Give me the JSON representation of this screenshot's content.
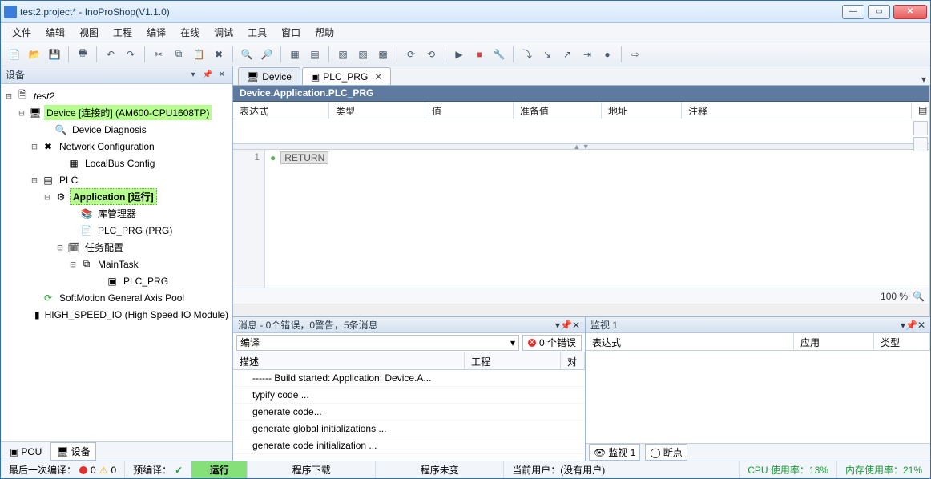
{
  "window": {
    "title": "test2.project* - InoProShop(V1.1.0)"
  },
  "menu": {
    "items": [
      "文件",
      "编辑",
      "视图",
      "工程",
      "编译",
      "在线",
      "调试",
      "工具",
      "窗口",
      "帮助"
    ]
  },
  "devicePanel": {
    "title": "设备",
    "tree": {
      "root": "test2",
      "device": "Device [连接的] (AM600-CPU1608TP)",
      "diag": "Device Diagnosis",
      "netcfg": "Network Configuration",
      "localbus": "LocalBus Config",
      "plc": "PLC",
      "app": "Application [运行]",
      "libmgr": "库管理器",
      "prgdecl": "PLC_PRG (PRG)",
      "taskcfg": "任务配置",
      "maintask": "MainTask",
      "prgcall": "PLC_PRG",
      "softmotion": "SoftMotion General Axis Pool",
      "hsio": "HIGH_SPEED_IO (High Speed IO Module)"
    },
    "bottomTabs": {
      "pou": "POU",
      "dev": "设备"
    }
  },
  "editor": {
    "tabs": {
      "device": "Device",
      "prg": "PLC_PRG"
    },
    "path": "Device.Application.PLC_PRG",
    "varCols": {
      "expr": "表达式",
      "type": "类型",
      "value": "值",
      "prep": "准备值",
      "addr": "地址",
      "comment": "注释"
    },
    "code": {
      "line1": "1",
      "ret": "RETURN"
    },
    "zoom": "100 %"
  },
  "messages": {
    "title": "消息 - 0个错误，0警告，5条消息",
    "filter": "编译",
    "errbtn": "0 个错误",
    "cols": {
      "desc": "描述",
      "proj": "工程",
      "obj": "对"
    },
    "rows": [
      "------ Build started: Application: Device.A...",
      "typify code ...",
      "generate code...",
      "generate global initializations ...",
      "generate code initialization ..."
    ]
  },
  "watch": {
    "title": "监视 1",
    "cols": {
      "expr": "表达式",
      "app": "应用",
      "type": "类型"
    },
    "tabs": {
      "watch1": "监视 1",
      "bp": "断点"
    }
  },
  "status": {
    "lastCompile": "最后一次编译：",
    "err0": "0",
    "warn0": "0",
    "precompile": "预编译：",
    "run": "运行",
    "download": "程序下载",
    "unchanged": "程序未变",
    "user": "当前用户：(没有用户)",
    "cpu": "CPU 使用率：13%",
    "mem": "内存使用率：21%"
  }
}
